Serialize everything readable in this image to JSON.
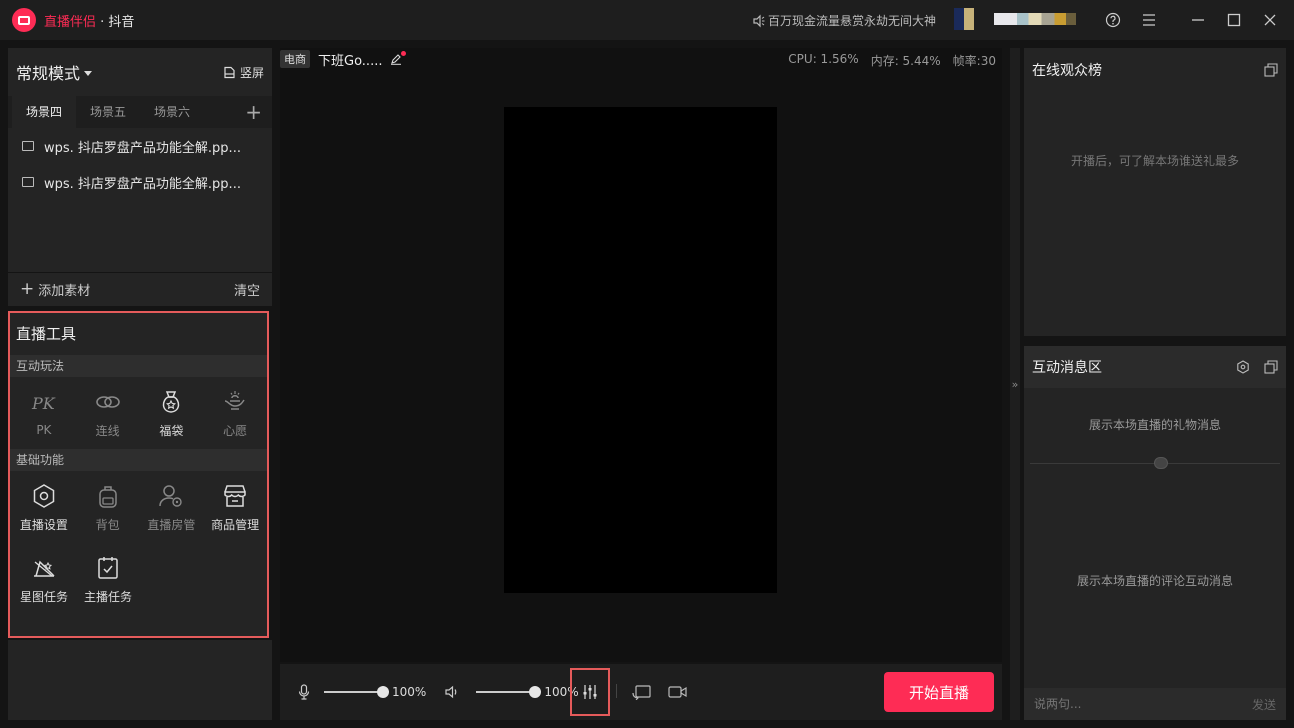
{
  "titlebar": {
    "brand": "直播伴侣",
    "platform": " · 抖音",
    "notice": "百万现金流量悬赏永劫无间大神",
    "help_icon": "question-circle-icon",
    "menu_icon": "hamburger-menu-icon",
    "min_icon": "minimize-icon",
    "max_icon": "maximize-icon",
    "close_icon": "close-icon"
  },
  "scene_panel": {
    "mode": "常规模式",
    "portrait": "竖屏",
    "tabs": [
      "场景四",
      "场景五",
      "场景六"
    ],
    "active_tab": 0,
    "sources": [
      "wps. 抖店罗盘产品功能全解.pp...",
      "wps. 抖店罗盘产品功能全解.pp..."
    ],
    "add_material": "添加素材",
    "clear": "清空"
  },
  "tools": {
    "title": "直播工具",
    "interactive_label": "互动玩法",
    "interactive": [
      {
        "label": "PK",
        "icon": "pk-icon"
      },
      {
        "label": "连线",
        "icon": "link-icon"
      },
      {
        "label": "福袋",
        "icon": "lucky-bag-icon"
      },
      {
        "label": "心愿",
        "icon": "wish-lamp-icon"
      }
    ],
    "basic_label": "基础功能",
    "basic": [
      {
        "label": "直播设置",
        "icon": "settings-hexagon-icon"
      },
      {
        "label": "背包",
        "icon": "backpack-icon"
      },
      {
        "label": "直播房管",
        "icon": "room-admin-icon"
      },
      {
        "label": "商品管理",
        "icon": "store-icon"
      },
      {
        "label": "星图任务",
        "icon": "star-map-icon"
      },
      {
        "label": "主播任务",
        "icon": "task-checklist-icon"
      }
    ]
  },
  "preview": {
    "tag": "电商",
    "title": "下班Go.....",
    "cpu": "CPU: 1.56%",
    "mem": "内存: 5.44%",
    "fps": "帧率:30"
  },
  "bottombar": {
    "mic_volume": "100%",
    "speaker_volume": "100%",
    "mic_level": 1.0,
    "speaker_level": 1.0,
    "go_live": "开始直播"
  },
  "audience": {
    "title": "在线观众榜",
    "hint": "开播后，可了解本场谁送礼最多"
  },
  "messages": {
    "title": "互动消息区",
    "gift_hint": "展示本场直播的礼物消息",
    "comment_hint": "展示本场直播的评论互动消息",
    "input_placeholder": "说两句...",
    "send": "发送"
  },
  "colors": {
    "accent": "#fe2c55",
    "highlight_border": "#e55b5b"
  }
}
